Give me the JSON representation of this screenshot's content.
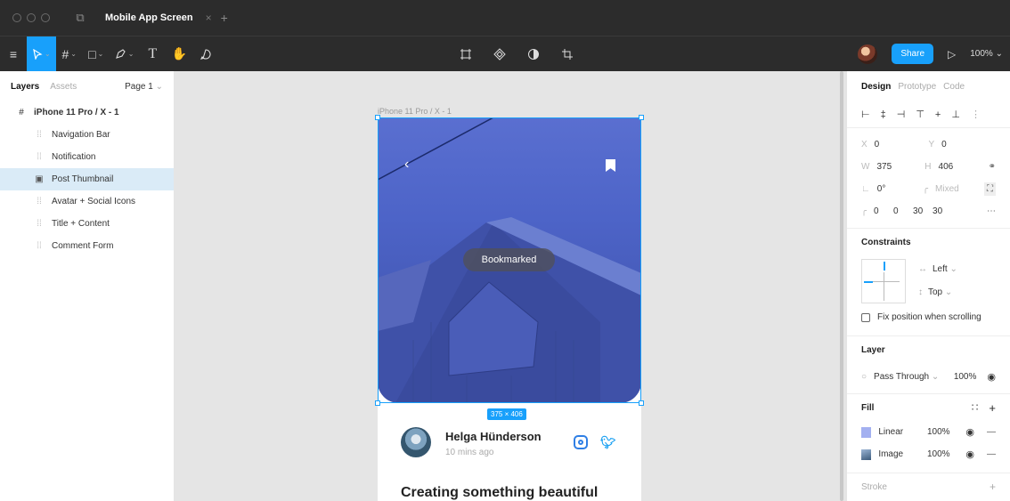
{
  "titlebar": {
    "tab_title": "Mobile App Screen",
    "tab_close": "×",
    "tab_add": "+",
    "figma_icon": "figma-logo-icon"
  },
  "toolbar": {
    "menu_icon": "≡",
    "tools": [
      "move-tool",
      "frame-tool",
      "shape-tool",
      "pen-tool",
      "text-tool",
      "hand-tool",
      "comment-tool"
    ],
    "text_tool": "T",
    "center_tools": [
      "component-tool",
      "instance-tool",
      "mask-tool",
      "crop-tool"
    ],
    "share_label": "Share",
    "zoom": "100%"
  },
  "layers_panel": {
    "tab_layers": "Layers",
    "tab_assets": "Assets",
    "page": "Page 1",
    "frame": "iPhone 11 Pro / X - 1",
    "items": [
      {
        "label": "Navigation Bar",
        "selected": false
      },
      {
        "label": "Notification",
        "selected": false
      },
      {
        "label": "Post Thumbnail",
        "selected": true
      },
      {
        "label": "Avatar + Social Icons",
        "selected": false
      },
      {
        "label": "Title + Content",
        "selected": false
      },
      {
        "label": "Comment Form",
        "selected": false
      }
    ]
  },
  "canvas": {
    "frame_label": "iPhone 11 Pro / X - 1",
    "toast": "Bookmarked",
    "dims": "375 × 406",
    "author_name": "Helga Hünderson",
    "author_time": "10 mins ago",
    "post_title": "Creating something beautiful"
  },
  "design_panel": {
    "tab_design": "Design",
    "tab_prototype": "Prototype",
    "tab_code": "Code",
    "x_label": "X",
    "x_value": "0",
    "y_label": "Y",
    "y_value": "0",
    "w_label": "W",
    "w_value": "375",
    "h_label": "H",
    "h_value": "406",
    "rotation": "0°",
    "corner_mixed": "Mixed",
    "corners": [
      "0",
      "0",
      "30",
      "30"
    ],
    "constraints_title": "Constraints",
    "constraint_h": "Left",
    "constraint_v": "Top",
    "fix_position": "Fix position when scrolling",
    "layer_title": "Layer",
    "blend_mode": "Pass Through",
    "layer_opacity": "100%",
    "fill_title": "Fill",
    "fills": [
      {
        "type": "Linear",
        "opacity": "100%",
        "color": "#a3b0f0"
      },
      {
        "type": "Image",
        "opacity": "100%",
        "color": "#3c5a7a"
      }
    ],
    "stroke_title": "Stroke"
  },
  "colors": {
    "accent": "#18a0fb",
    "dark_chrome": "#2c2c2c",
    "selection_row": "#daebf7"
  }
}
